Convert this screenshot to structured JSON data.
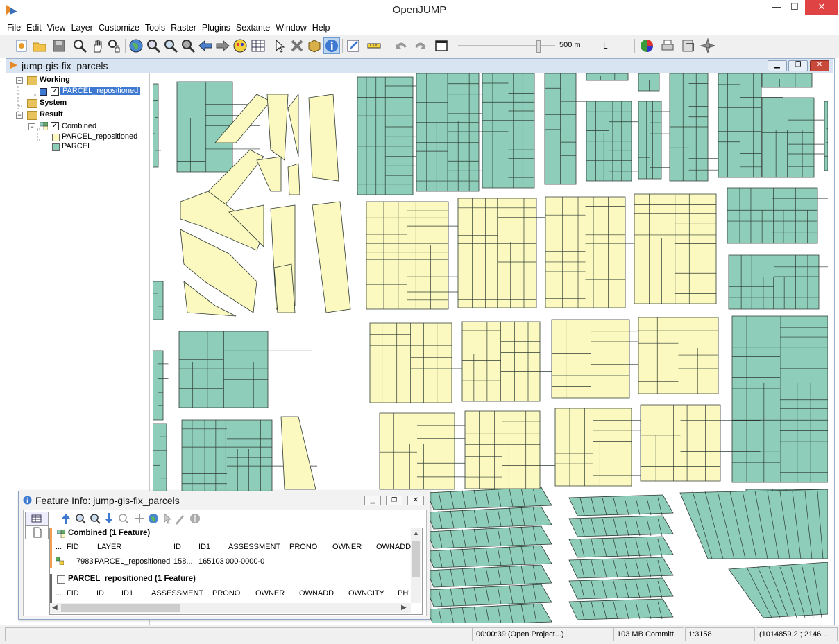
{
  "app": {
    "title": "OpenJUMP"
  },
  "window_controls": {
    "minimize": "—",
    "maximize": "☐",
    "close": "✕"
  },
  "menu": [
    "File",
    "Edit",
    "View",
    "Layer",
    "Customize",
    "Tools",
    "Raster",
    "Plugins",
    "Sextante",
    "Window",
    "Help"
  ],
  "toolbar": {
    "scale_label": "500 m",
    "scale_position": 0.82,
    "style_label": "L"
  },
  "project": {
    "title": "jump-gis-fix_parcels"
  },
  "tree": {
    "working": "Working",
    "working_layer": "PARCEL_repositioned",
    "system": "System",
    "result": "Result",
    "combined": "Combined",
    "combined_items": [
      "PARCEL_repositioned",
      "PARCEL"
    ]
  },
  "colors": {
    "parcel": "#8ecdb9",
    "parcel_repositioned": "#fbf9bf",
    "outline": "#2d3a33",
    "selection": "#3d79d0"
  },
  "feature_info": {
    "title": "Feature Info: jump-gis-fix_parcels",
    "section1": "Combined (1 Feature)",
    "section1_headers": [
      "...",
      "FID",
      "LAYER",
      "ID",
      "ID1",
      "ASSESSMENT",
      "PRONO",
      "OWNER",
      "OWNADD"
    ],
    "section1_row": [
      "7983",
      "PARCEL_repositioned",
      "158...",
      "165103",
      "000-0000-0"
    ],
    "section2": "PARCEL_repositioned (1 Feature)",
    "section2_headers": [
      "...",
      "FID",
      "ID",
      "ID1",
      "ASSESSMENT",
      "PRONO",
      "OWNER",
      "OWNADD",
      "OWNCITY",
      "PH'"
    ]
  },
  "status": {
    "message": "",
    "timing": "00:00:39 (Open Project...)",
    "memory": "103 MB Committ...",
    "scale": "1:3158",
    "coords": "(1014859.2 ; 2146..."
  }
}
